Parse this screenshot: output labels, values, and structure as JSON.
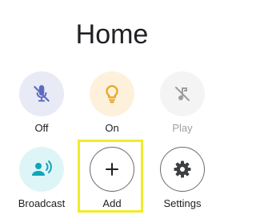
{
  "page": {
    "title": "Home"
  },
  "actions": {
    "off": {
      "label": "Off",
      "icon": "mic-off-icon"
    },
    "on": {
      "label": "On",
      "icon": "lightbulb-icon"
    },
    "play": {
      "label": "Play",
      "icon": "music-note-off-icon"
    },
    "broadcast": {
      "label": "Broadcast",
      "icon": "broadcast-person-icon"
    },
    "add": {
      "label": "Add",
      "icon": "plus-icon"
    },
    "settings": {
      "label": "Settings",
      "icon": "gear-icon"
    }
  },
  "colors": {
    "off_bg": "#e8eaf6",
    "off_icon": "#5c6bc0",
    "on_bg": "#fdf1dc",
    "on_icon": "#e8a41a",
    "play_bg": "#f4f4f4",
    "play_icon": "#9e9e9e",
    "broadcast_bg": "#def5f8",
    "broadcast_icon": "#12a4b8",
    "highlight": "#f0ec2b"
  }
}
